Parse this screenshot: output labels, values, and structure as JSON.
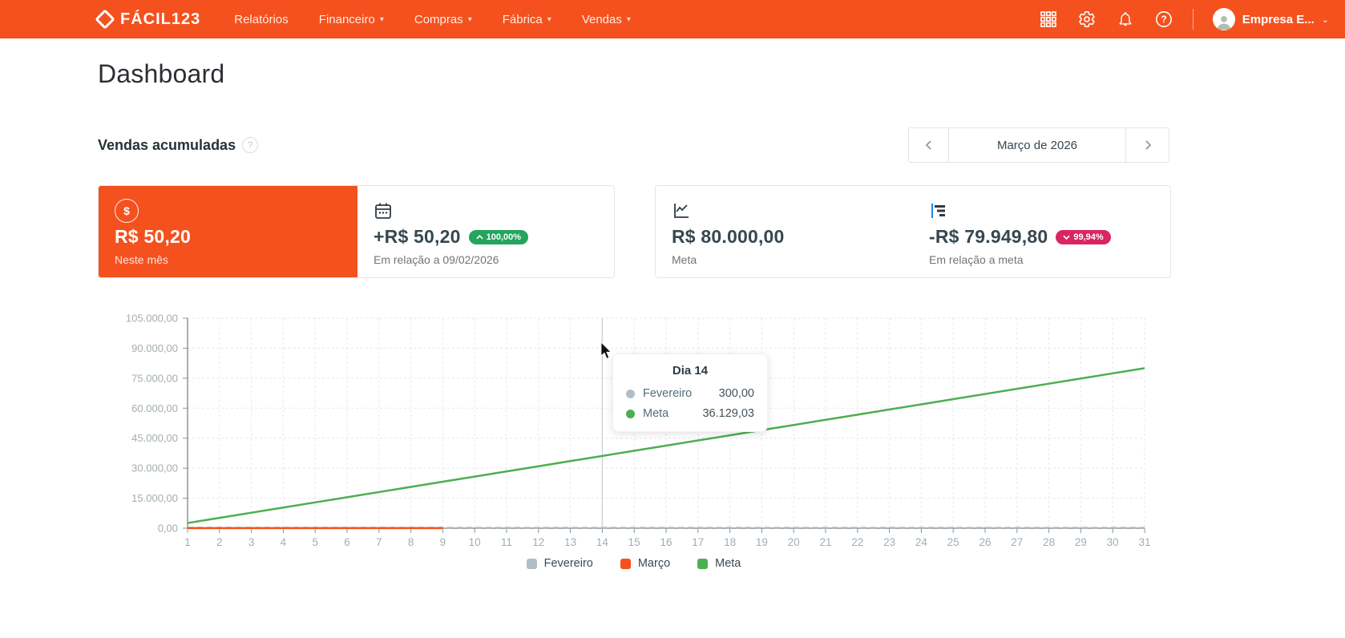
{
  "header": {
    "brand": "FÁCIL123",
    "nav": [
      {
        "label": "Relatórios",
        "dropdown": false
      },
      {
        "label": "Financeiro",
        "dropdown": true
      },
      {
        "label": "Compras",
        "dropdown": true
      },
      {
        "label": "Fábrica",
        "dropdown": true
      },
      {
        "label": "Vendas",
        "dropdown": true
      }
    ],
    "icons": [
      "apps-grid-icon",
      "gear-icon",
      "bell-icon",
      "help-icon"
    ],
    "account_name": "Empresa E...",
    "help_glyph": "?"
  },
  "page": {
    "title": "Dashboard"
  },
  "section": {
    "title": "Vendas acumuladas",
    "help_glyph": "?"
  },
  "date_nav": {
    "label": "Março de 2026"
  },
  "cards": [
    {
      "icon": "dollar-icon",
      "value": "R$ 50,20",
      "label": "Neste mês",
      "dollar_glyph": "$"
    },
    {
      "icon": "calendar-icon",
      "value": "+R$ 50,20",
      "badge": "100,00%",
      "badge_dir": "up",
      "label": "Em relação a 09/02/2026"
    },
    {
      "icon": "line-chart-icon",
      "value": "R$ 80.000,00",
      "label": "Meta"
    },
    {
      "icon": "bar-chart-icon",
      "value": "-R$ 79.949,80",
      "badge": "99,94%",
      "badge_dir": "down",
      "label": "Em relação a meta"
    }
  ],
  "tooltip": {
    "title": "Dia 14",
    "rows": [
      {
        "name": "Fevereiro",
        "value": "300,00",
        "color": "#b0bec5"
      },
      {
        "name": "Meta",
        "value": "36.129,03",
        "color": "#4caf50"
      }
    ]
  },
  "legend": [
    {
      "label": "Fevereiro",
      "color": "#b0bec5"
    },
    {
      "label": "Março",
      "color": "#f4511e"
    },
    {
      "label": "Meta",
      "color": "#4caf50"
    }
  ],
  "colors": {
    "brand_orange": "#f4511e",
    "badge_green": "#23a55e",
    "badge_pink": "#d92662",
    "meta_green": "#4caf50",
    "fevereiro_gray": "#b0bec5",
    "axis_gray": "#8d9499",
    "grid_gray": "#e5e8ea",
    "tick_label": "#a3adb3"
  },
  "chart_data": {
    "type": "line",
    "title": "Vendas acumuladas",
    "x": [
      1,
      2,
      3,
      4,
      5,
      6,
      7,
      8,
      9,
      10,
      11,
      12,
      13,
      14,
      15,
      16,
      17,
      18,
      19,
      20,
      21,
      22,
      23,
      24,
      25,
      26,
      27,
      28,
      29,
      30,
      31
    ],
    "xlabel": "",
    "ylabel": "",
    "ylim": [
      0,
      105000
    ],
    "ytick_step": 15000,
    "ytick_labels": [
      "0,00",
      "15.000,00",
      "30.000,00",
      "45.000,00",
      "60.000,00",
      "75.000,00",
      "90.000,00",
      "105.000,00"
    ],
    "grid": true,
    "legend_position": "bottom",
    "hover_day": 14,
    "series": [
      {
        "name": "Fevereiro",
        "color": "#b0bec5",
        "style": "dashed",
        "values": [
          300,
          300,
          300,
          300,
          300,
          300,
          300,
          300,
          300,
          300,
          300,
          300,
          300,
          300,
          300,
          300,
          300,
          300,
          300,
          300,
          300,
          300,
          300,
          300,
          300,
          300,
          300,
          300,
          300,
          300,
          300
        ]
      },
      {
        "name": "Março",
        "color": "#f4511e",
        "style": "solid",
        "values": [
          50.2,
          50.2,
          50.2,
          50.2,
          50.2,
          50.2,
          50.2,
          50.2,
          50.2,
          null,
          null,
          null,
          null,
          null,
          null,
          null,
          null,
          null,
          null,
          null,
          null,
          null,
          null,
          null,
          null,
          null,
          null,
          null,
          null,
          null,
          null
        ]
      },
      {
        "name": "Meta",
        "color": "#4caf50",
        "style": "solid",
        "values": [
          2580.65,
          5161.29,
          7741.94,
          10322.58,
          12903.23,
          15483.87,
          18064.52,
          20645.16,
          23225.81,
          25806.45,
          28387.1,
          30967.74,
          33548.39,
          36129.03,
          38709.68,
          41290.32,
          43870.97,
          46451.61,
          49032.26,
          51612.9,
          54193.55,
          56774.19,
          59354.84,
          61935.48,
          64516.13,
          67096.77,
          69677.42,
          72258.06,
          74838.71,
          77419.35,
          80000.0
        ]
      }
    ]
  }
}
